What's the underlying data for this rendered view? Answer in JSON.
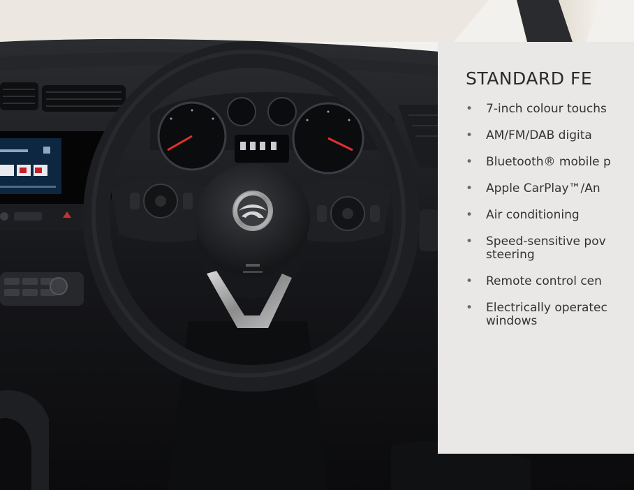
{
  "feature_panel": {
    "title": "STANDARD FE",
    "items": [
      {
        "text": "7-inch colour touchs"
      },
      {
        "text": "AM/FM/DAB digita"
      },
      {
        "text": "Bluetooth® mobile p"
      },
      {
        "text": "Apple CarPlay™/An"
      },
      {
        "text": "Air conditioning"
      },
      {
        "text": "Speed-sensitive pov steering"
      },
      {
        "text": "Remote control cen"
      },
      {
        "text": "Electrically operatec windows"
      }
    ],
    "bullet": "•"
  },
  "colors": {
    "panel_background": "#e9e8e6",
    "title_text": "#2b2b2b",
    "body_text": "#333333",
    "cabin_dark": "#141518",
    "headliner": "#ede9e3"
  }
}
